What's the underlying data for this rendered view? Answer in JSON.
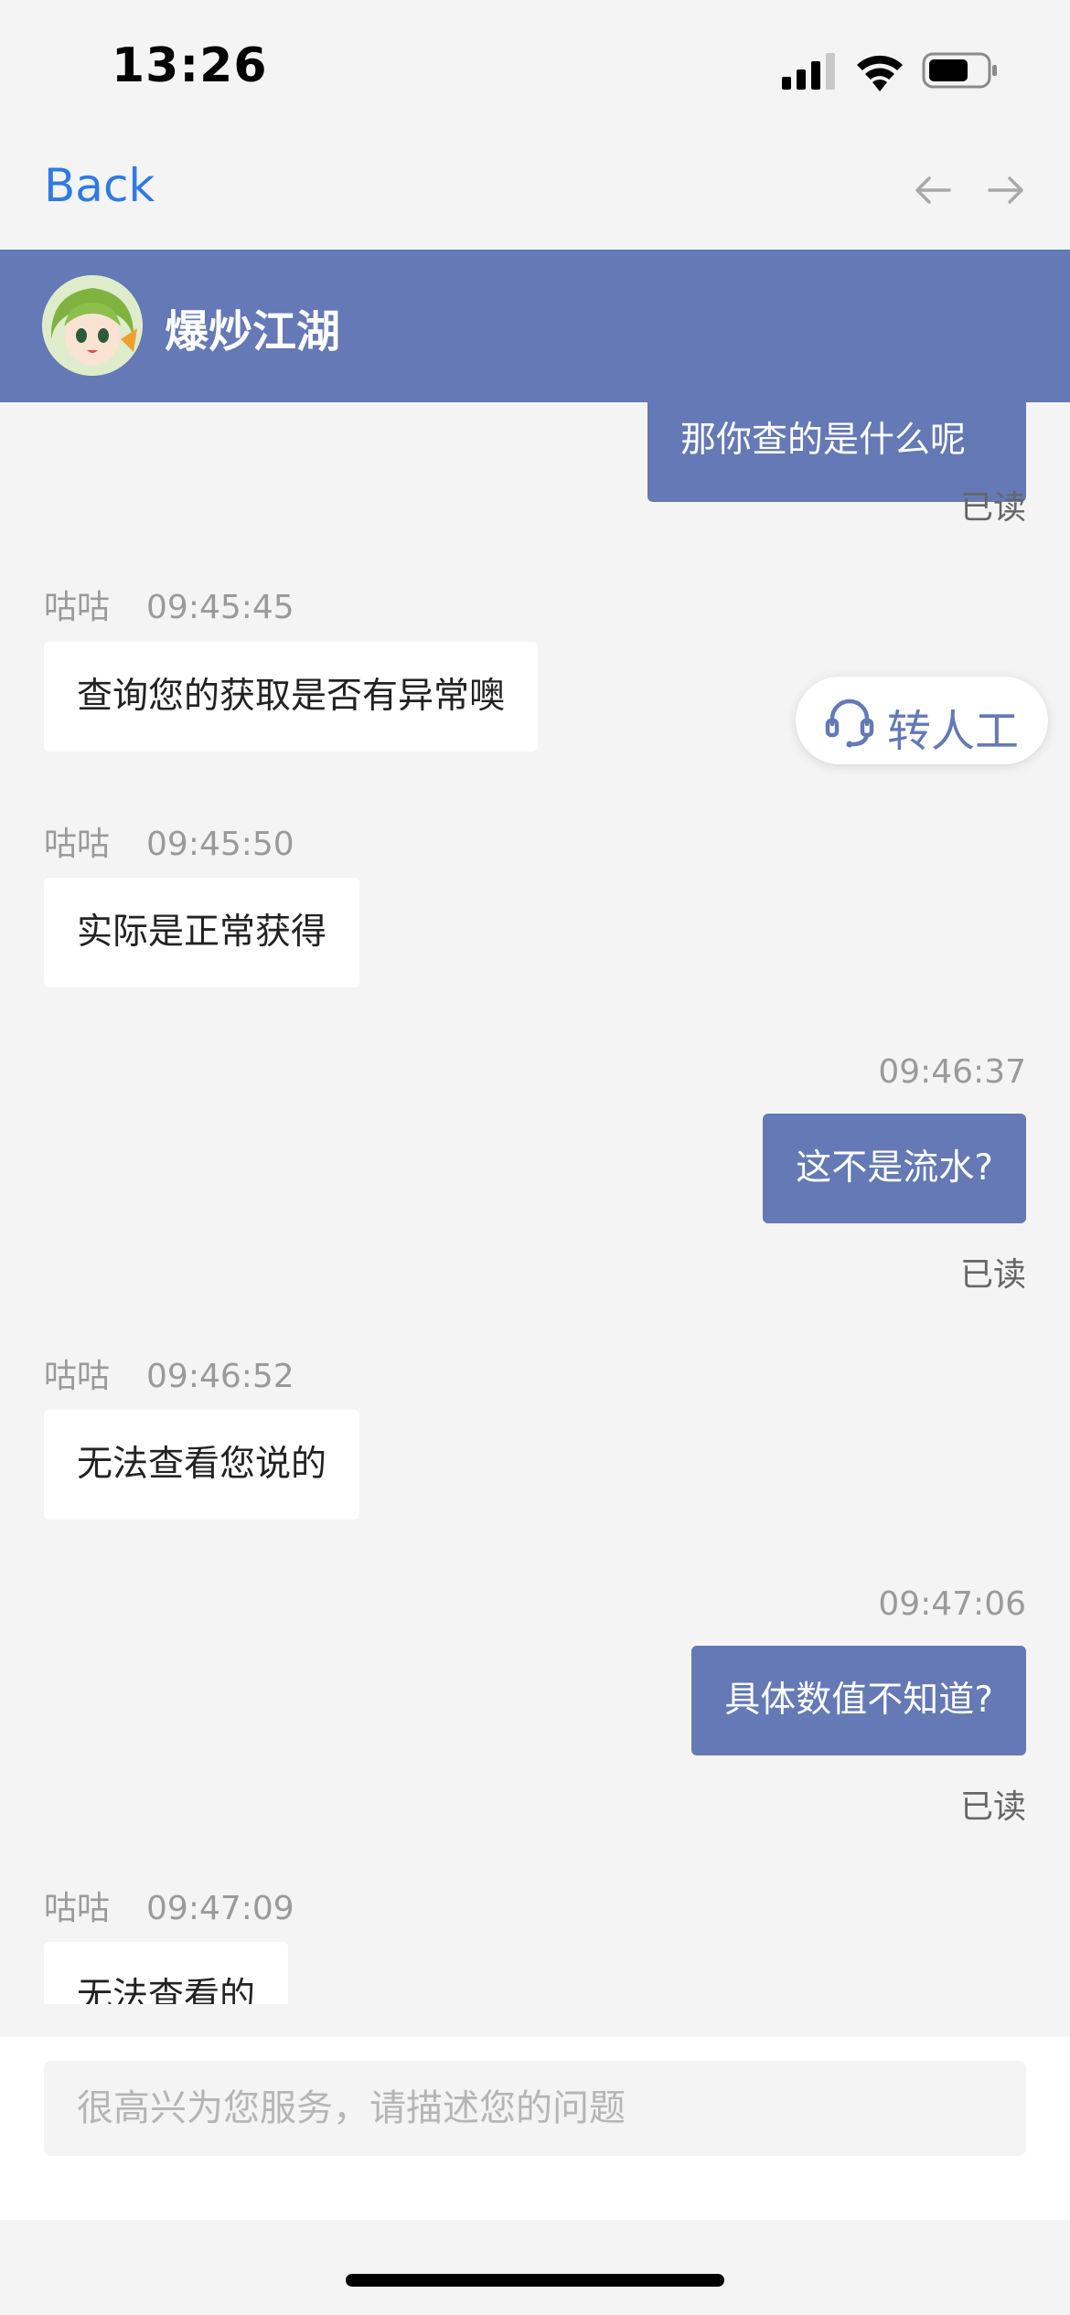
{
  "status_bar": {
    "time": "13:26",
    "icons": [
      "cellular-signal-icon",
      "wifi-icon",
      "battery-icon"
    ]
  },
  "nav": {
    "back_label": "Back",
    "prev_icon": "arrow-left-icon",
    "next_icon": "arrow-right-icon"
  },
  "header": {
    "title": "爆炒江湖",
    "avatar": "avatar-icon"
  },
  "colors": {
    "accent": "#6479b5",
    "link": "#2f7ae5",
    "background": "#f4f4f4"
  },
  "transfer_button": {
    "label": "转人工",
    "icon": "headset-icon"
  },
  "messages": [
    {
      "side": "right",
      "text": "那你查的是什么呢",
      "read": "已读"
    },
    {
      "side": "left",
      "sender": "咕咕",
      "time": "09:45:45",
      "text": "查询您的获取是否有异常噢"
    },
    {
      "side": "left",
      "sender": "咕咕",
      "time": "09:45:50",
      "text": "实际是正常获得"
    },
    {
      "side": "right",
      "time": "09:46:37",
      "text": "这不是流水?",
      "read": "已读"
    },
    {
      "side": "left",
      "sender": "咕咕",
      "time": "09:46:52",
      "text": "无法查看您说的"
    },
    {
      "side": "right",
      "time": "09:47:06",
      "text": "具体数值不知道?",
      "read": "已读"
    },
    {
      "side": "left",
      "sender": "咕咕",
      "time": "09:47:09",
      "text": "无法查看的"
    }
  ],
  "input": {
    "placeholder": "很高兴为您服务，请描述您的问题",
    "value": ""
  }
}
